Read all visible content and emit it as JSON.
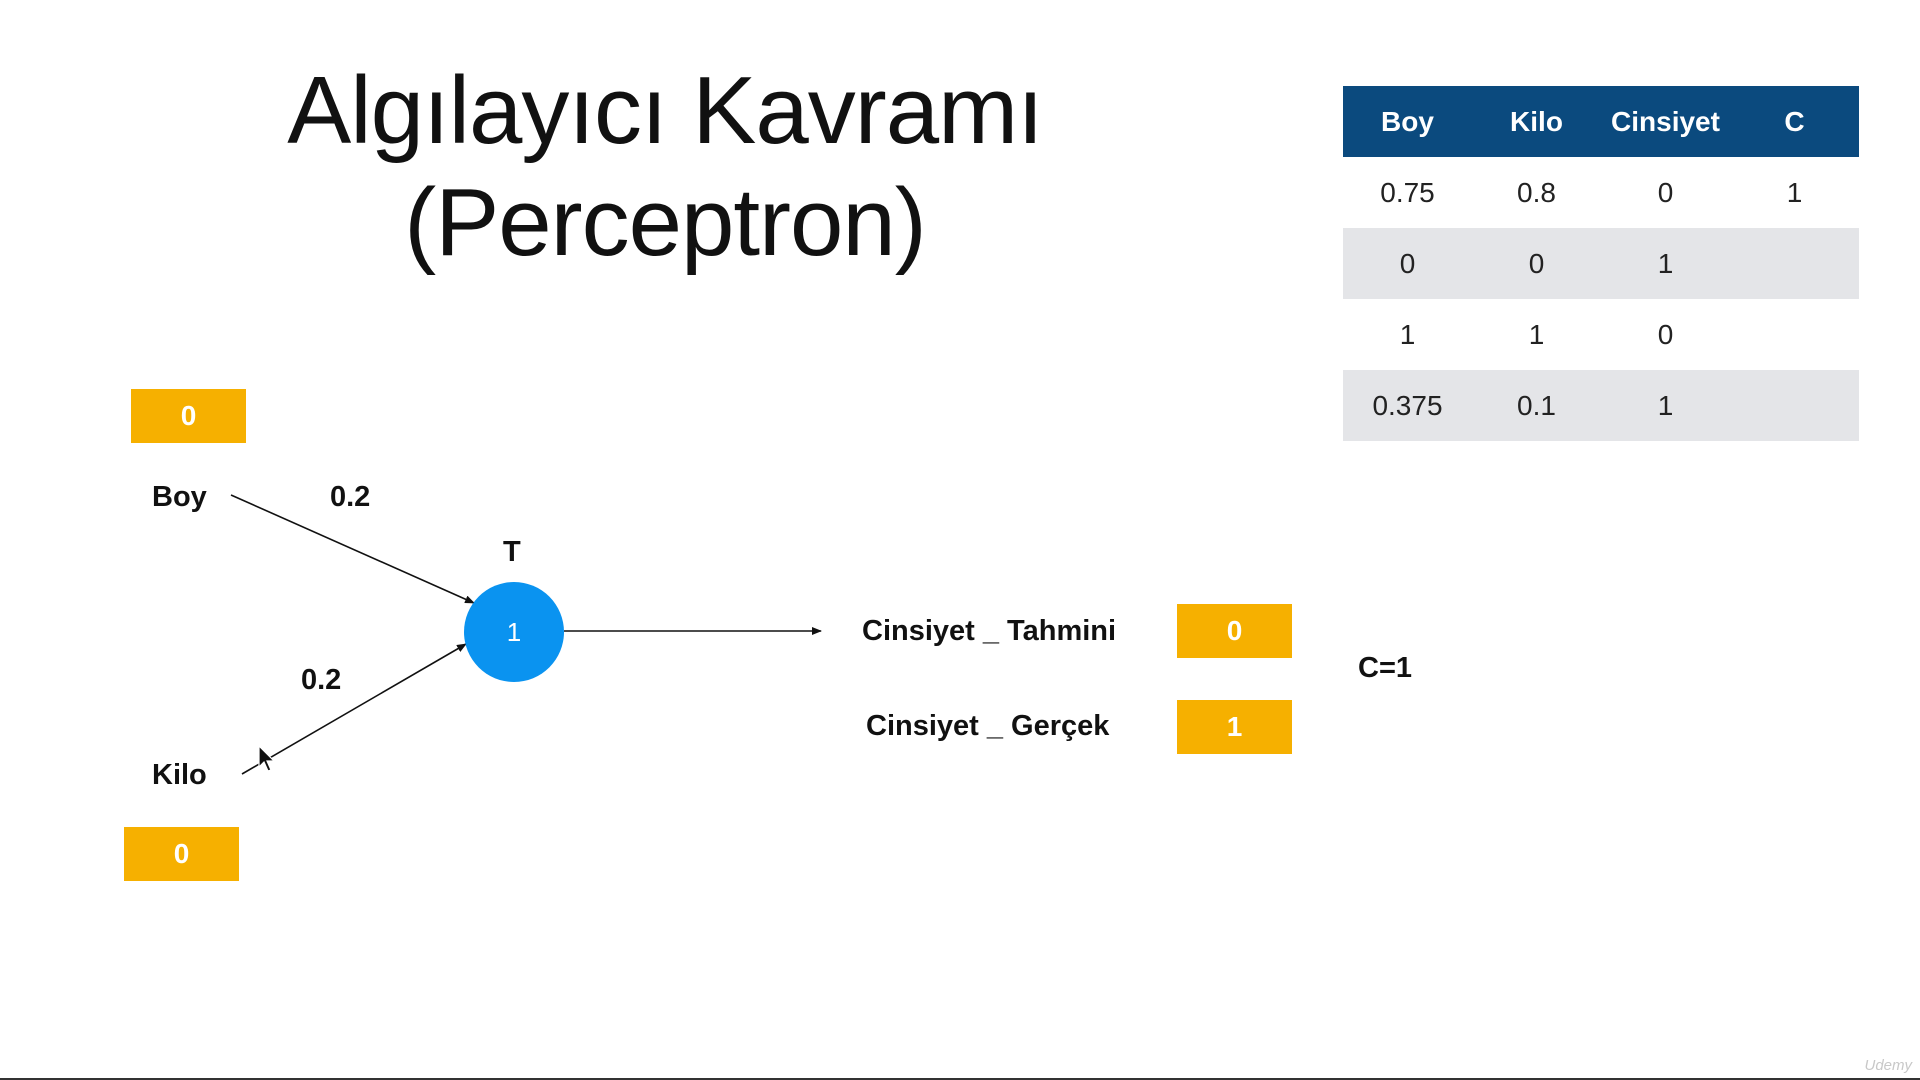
{
  "title": {
    "line1": "Algılayıcı Kavramı",
    "line2": "(Perceptron)"
  },
  "table": {
    "headers": [
      "Boy",
      "Kilo",
      "Cinsiyet",
      "C"
    ],
    "rows": [
      [
        "0.75",
        "0.8",
        "0",
        "1"
      ],
      [
        "0",
        "0",
        "1",
        ""
      ],
      [
        "1",
        "1",
        "0",
        ""
      ],
      [
        "0.375",
        "0.1",
        "1",
        ""
      ]
    ]
  },
  "diagram": {
    "boy_label": "Boy",
    "boy_value": "0",
    "boy_weight": "0.2",
    "kilo_label": "Kilo",
    "kilo_value": "0",
    "kilo_weight": "0.2",
    "threshold_label": "T",
    "neuron_value": "1",
    "prediction_label": "Cinsiyet _ Tahmini",
    "prediction_value": "0",
    "actual_label": "Cinsiyet _ Gerçek",
    "actual_value": "1",
    "c_note": "C=1"
  },
  "colors": {
    "accent_orange": "#f6b000",
    "neuron_blue": "#0a93f0",
    "table_header": "#0b4a7e",
    "table_alt_row": "#e4e5e8"
  },
  "watermark": "Udemy"
}
